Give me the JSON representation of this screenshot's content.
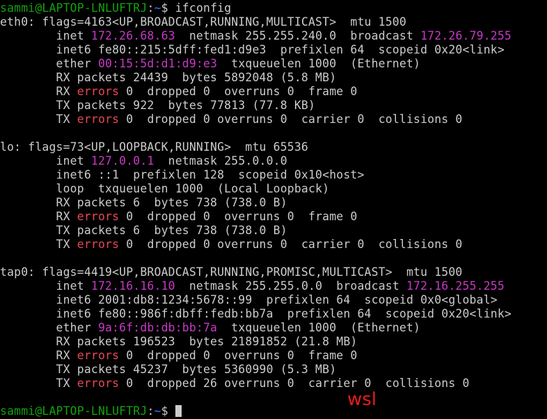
{
  "prompt": {
    "user_host": "sammi@LAPTOP-LNLUFTRJ",
    "sep": ":",
    "path": "~",
    "symbol": "$ "
  },
  "command": "ifconfig",
  "watermark": "wsl",
  "eth0": {
    "l1": "eth0: flags=4163<UP,BROADCAST,RUNNING,MULTICAST>  mtu 1500",
    "l2a": "        inet ",
    "l2b": "172.26.68.63",
    "l2c": "  netmask 255.255.240.0  broadcast ",
    "l2d": "172.26.79.255",
    "l3": "        inet6 fe80::215:5dff:fed1:d9e3  prefixlen 64  scopeid 0x20<link>",
    "l4a": "        ether ",
    "l4b": "00:15:5d:d1:d9:e3",
    "l4c": "  txqueuelen 1000  (Ethernet)",
    "l5": "        RX packets 24439  bytes 5892048 (5.8 MB)",
    "l6a": "        RX ",
    "l6b": "errors",
    "l6c": " 0  dropped 0  overruns 0  frame 0",
    "l7": "        TX packets 922  bytes 77813 (77.8 KB)",
    "l8a": "        TX ",
    "l8b": "errors",
    "l8c": " 0  dropped 0 overruns 0  carrier 0  collisions 0"
  },
  "lo": {
    "l1": "lo: flags=73<UP,LOOPBACK,RUNNING>  mtu 65536",
    "l2a": "        inet ",
    "l2b": "127.0.0.1",
    "l2c": "  netmask 255.0.0.0",
    "l3": "        inet6 ::1  prefixlen 128  scopeid 0x10<host>",
    "l4": "        loop  txqueuelen 1000  (Local Loopback)",
    "l5": "        RX packets 6  bytes 738 (738.0 B)",
    "l6a": "        RX ",
    "l6b": "errors",
    "l6c": " 0  dropped 0  overruns 0  frame 0",
    "l7": "        TX packets 6  bytes 738 (738.0 B)",
    "l8a": "        TX ",
    "l8b": "errors",
    "l8c": " 0  dropped 0 overruns 0  carrier 0  collisions 0"
  },
  "tap0": {
    "l1": "tap0: flags=4419<UP,BROADCAST,RUNNING,PROMISC,MULTICAST>  mtu 1500",
    "l2a": "        inet ",
    "l2b": "172.16.16.10",
    "l2c": "  netmask 255.255.0.0  broadcast ",
    "l2d": "172.16.255.255",
    "l3": "        inet6 2001:db8:1234:5678::99  prefixlen 64  scopeid 0x0<global>",
    "l4": "        inet6 fe80::986f:dbff:fedb:bb7a  prefixlen 64  scopeid 0x20<link>",
    "l5a": "        ether ",
    "l5b": "9a:6f:db:db:bb:7a",
    "l5c": "  txqueuelen 1000  (Ethernet)",
    "l6": "        RX packets 196523  bytes 21891852 (21.8 MB)",
    "l7a": "        RX ",
    "l7b": "errors",
    "l7c": " 0  dropped 0  overruns 0  frame 0",
    "l8": "        TX packets 45237  bytes 5360990 (5.3 MB)",
    "l9a": "        TX ",
    "l9b": "errors",
    "l9c": " 0  dropped 26 overruns 0  carrier 0  collisions 0"
  },
  "colors": {
    "user": "#13a10e",
    "path": "#3b78ff",
    "address": "#c839c5",
    "errors": "#e74856",
    "text": "#cccccc"
  }
}
